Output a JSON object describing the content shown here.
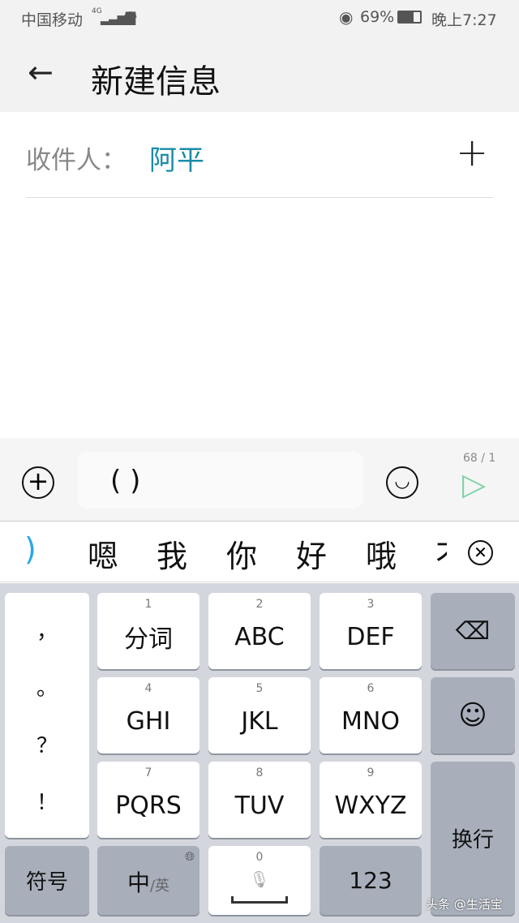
{
  "status": {
    "carrier": "中国移动",
    "network": "4G",
    "battery": "69%",
    "time": "晚上7:27"
  },
  "header": {
    "title": "新建信息"
  },
  "recipient": {
    "label": "收件人：",
    "name": "阿平"
  },
  "compose": {
    "text": "( )",
    "counter": "68 / 1"
  },
  "candidates": {
    "current": ")",
    "items": [
      "嗯",
      "我",
      "你",
      "好",
      "哦",
      "不"
    ]
  },
  "keyboard": {
    "punct": [
      "，",
      "。",
      "？",
      "！"
    ],
    "keys": [
      {
        "num": "1",
        "label": "分词"
      },
      {
        "num": "2",
        "label": "ABC"
      },
      {
        "num": "3",
        "label": "DEF"
      },
      {
        "num": "4",
        "label": "GHI"
      },
      {
        "num": "5",
        "label": "JKL"
      },
      {
        "num": "6",
        "label": "MNO"
      },
      {
        "num": "7",
        "label": "PQRS"
      },
      {
        "num": "8",
        "label": "TUV"
      },
      {
        "num": "9",
        "label": "WXYZ"
      }
    ],
    "symbols": "符号",
    "lang_main": "中",
    "lang_alt": "/英",
    "space_num": "0",
    "numbers": "123",
    "enter": "换行"
  },
  "watermark": "头条 @生活宝",
  "colors": {
    "accent": "#1a8ca8",
    "send": "#7fd3a8",
    "cursor": "#2aa7e8"
  }
}
